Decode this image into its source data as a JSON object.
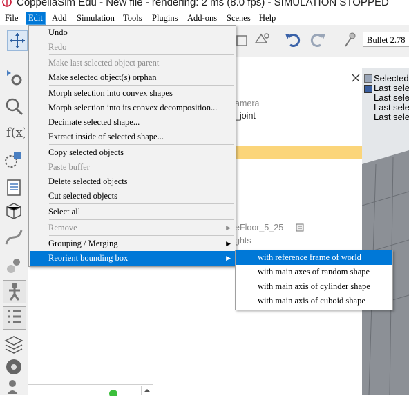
{
  "window": {
    "title": "CoppeliaSim Edu - New file - rendering: 2 ms (8.0 fps) - SIMULATION STOPPED"
  },
  "menubar": [
    {
      "label": "File",
      "name": "menu-file"
    },
    {
      "label": "Edit",
      "name": "menu-edit"
    },
    {
      "label": "Add",
      "name": "menu-add"
    },
    {
      "label": "Simulation",
      "name": "menu-simulation"
    },
    {
      "label": "Tools",
      "name": "menu-tools"
    },
    {
      "label": "Plugins",
      "name": "menu-plugins"
    },
    {
      "label": "Add-ons",
      "name": "menu-addons"
    },
    {
      "label": "Scenes",
      "name": "menu-scenes"
    },
    {
      "label": "Help",
      "name": "menu-help"
    }
  ],
  "toolbar": {
    "physics_engine": "Bullet 2.78",
    "icons": [
      "move-icon",
      "shape-icon",
      "shape-edit-icon",
      "undo-icon",
      "redo-icon",
      "dynamics-icon"
    ]
  },
  "left_toolbar": {
    "icons": [
      "object-properties-icon",
      "calculation-module-icon",
      "script-icon",
      "shapes-icon",
      "page-icon",
      "model-browser-icon",
      "path-icon",
      "collision-icon",
      "robot-icon",
      "hierarchy-icon",
      "layers-icon",
      "video-recorder-icon",
      "user-settings-icon"
    ]
  },
  "edit_menu": {
    "items": [
      {
        "label": "Undo",
        "disabled": false
      },
      {
        "label": "Redo",
        "disabled": true
      },
      {
        "label": "Make last selected object parent",
        "disabled": true
      },
      {
        "label": "Make selected object(s) orphan",
        "disabled": false
      },
      {
        "label": "Morph selection into convex shapes",
        "disabled": false
      },
      {
        "label": "Morph selection into its convex decomposition...",
        "disabled": false
      },
      {
        "label": "Decimate selected shape...",
        "disabled": false
      },
      {
        "label": "Extract inside of selected shape...",
        "disabled": false
      },
      {
        "label": "Copy selected objects",
        "disabled": false
      },
      {
        "label": "Paste buffer",
        "disabled": true
      },
      {
        "label": "Delete selected objects",
        "disabled": false
      },
      {
        "label": "Cut selected objects",
        "disabled": false
      },
      {
        "label": "Select all",
        "disabled": false
      },
      {
        "label": "Remove",
        "disabled": true
      },
      {
        "label": "Grouping / Merging",
        "disabled": false
      },
      {
        "label": "Reorient bounding box",
        "disabled": false
      }
    ]
  },
  "reorient_submenu": {
    "items": [
      {
        "label": "with reference frame of world"
      },
      {
        "label": "with main axes of random shape"
      },
      {
        "label": "with main axis of cylinder shape"
      },
      {
        "label": "with main axis of cuboid shape"
      }
    ]
  },
  "scene_hierarchy": {
    "rows": [
      "amera",
      "_joint",
      "eFloor_5_25",
      "ghts"
    ]
  },
  "viewport_info": {
    "lines": [
      "Selected",
      "Last sele",
      "Last sele",
      "Last sele",
      "Last sele"
    ]
  },
  "colors": {
    "accent": "#0078d7",
    "scene_highlight": "#fbd57a",
    "menu_background": "#f2f2f2",
    "disabled_text": "#8d8d8d"
  }
}
